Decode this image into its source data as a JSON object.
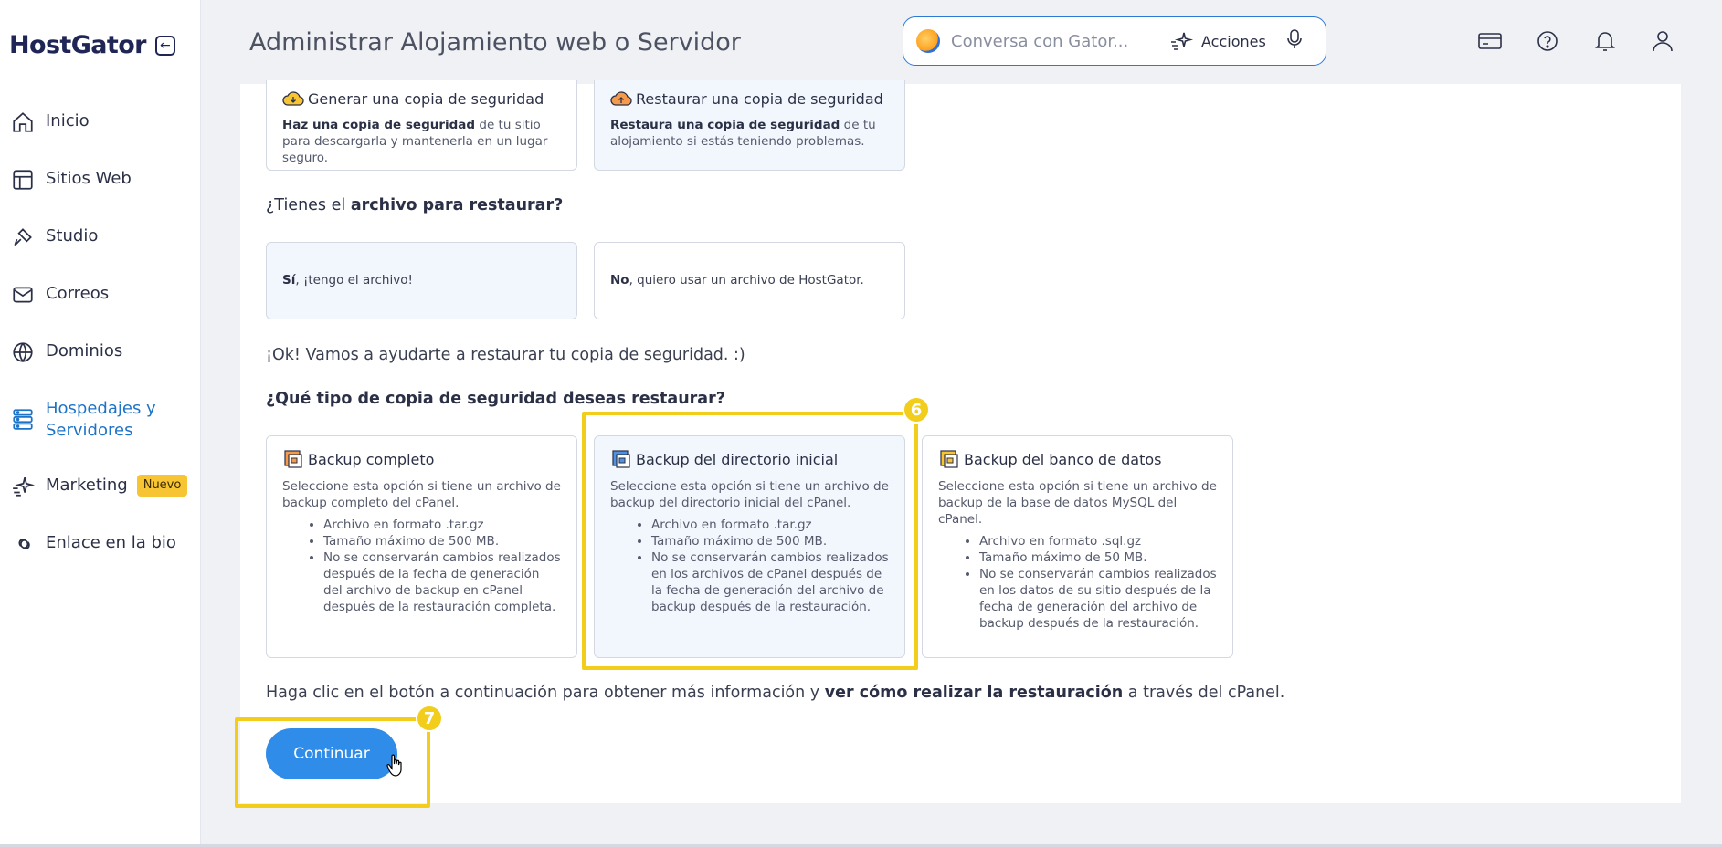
{
  "sidebar": {
    "logo": "HostGator",
    "items": [
      {
        "label": "Inicio",
        "icon": "home-icon"
      },
      {
        "label": "Sitios Web",
        "icon": "layout-icon"
      },
      {
        "label": "Studio",
        "icon": "brush-icon"
      },
      {
        "label": "Correos",
        "icon": "mail-icon"
      },
      {
        "label": "Dominios",
        "icon": "globe-icon"
      },
      {
        "label": "Hospedajes y Servidores",
        "label_line1": "Hospedajes y",
        "label_line2": "Servidores",
        "icon": "server-icon",
        "active": true
      },
      {
        "label": "Marketing",
        "icon": "sparkle-icon",
        "badge": "Nuevo"
      },
      {
        "label": "Enlace en la bio",
        "icon": "link-icon"
      }
    ]
  },
  "header": {
    "title": "Administrar Alojamiento web o Servidor",
    "chat_placeholder": "Conversa con Gator...",
    "actions_label": "Acciones"
  },
  "backup_cards": {
    "generate": {
      "title": "Generar una copia de seguridad",
      "desc_bold": "Haz una copia de seguridad",
      "desc_rest": " de tu sitio para descargarla y mantenerla en un lugar seguro."
    },
    "restore": {
      "title": "Restaurar una copia de seguridad",
      "desc_bold": "Restaura una copia de seguridad",
      "desc_rest": " de tu alojamiento si estás teniendo problemas."
    }
  },
  "file_question": {
    "prefix": "¿Tienes el ",
    "bold": "archivo para restaurar?",
    "yes_bold": "Sí",
    "yes_rest": ", ¡tengo el archivo!",
    "no_bold": "No",
    "no_rest": ", quiero usar un archivo de HostGator."
  },
  "ok_message": "¡Ok! Vamos a ayudarte a restaurar tu copia de seguridad. :)",
  "type_question": "¿Qué tipo de copia de seguridad deseas restaurar?",
  "types": [
    {
      "title": "Backup completo",
      "desc": "Seleccione esta opción si tiene un archivo de backup completo del cPanel.",
      "bullets": [
        "Archivo en formato .tar.gz",
        "Tamaño máximo de 500 MB.",
        "No se conservarán cambios realizados después de la fecha de generación del archivo de backup en cPanel después de la restauración completa."
      ]
    },
    {
      "title": "Backup del directorio inicial",
      "desc": "Seleccione esta opción si tiene un archivo de backup del directorio inicial del cPanel.",
      "bullets": [
        "Archivo en formato .tar.gz",
        "Tamaño máximo de 500 MB.",
        "No se conservarán cambios realizados en los archivos de cPanel después de la fecha de generación del archivo de backup después de la restauración."
      ]
    },
    {
      "title": "Backup del banco de datos",
      "desc": "Seleccione esta opción si tiene un archivo de backup de la base de datos MySQL del cPanel.",
      "bullets": [
        "Archivo en formato .sql.gz",
        "Tamaño máximo de 50 MB.",
        "No se conservarán cambios realizados en los datos de su sitio después de la fecha de generación del archivo de backup después de la restauración."
      ]
    }
  ],
  "instructions": {
    "prefix": "Haga clic en el botón a continuación para obtener más información y ",
    "bold": "ver cómo realizar la restauración",
    "suffix": " a través del cPanel."
  },
  "continue_label": "Continuar",
  "steps": {
    "six": "6",
    "seven": "7"
  },
  "colors": {
    "accent": "#2f8ce8",
    "highlight": "#f2cd1b",
    "active_nav": "#1c73c7"
  }
}
